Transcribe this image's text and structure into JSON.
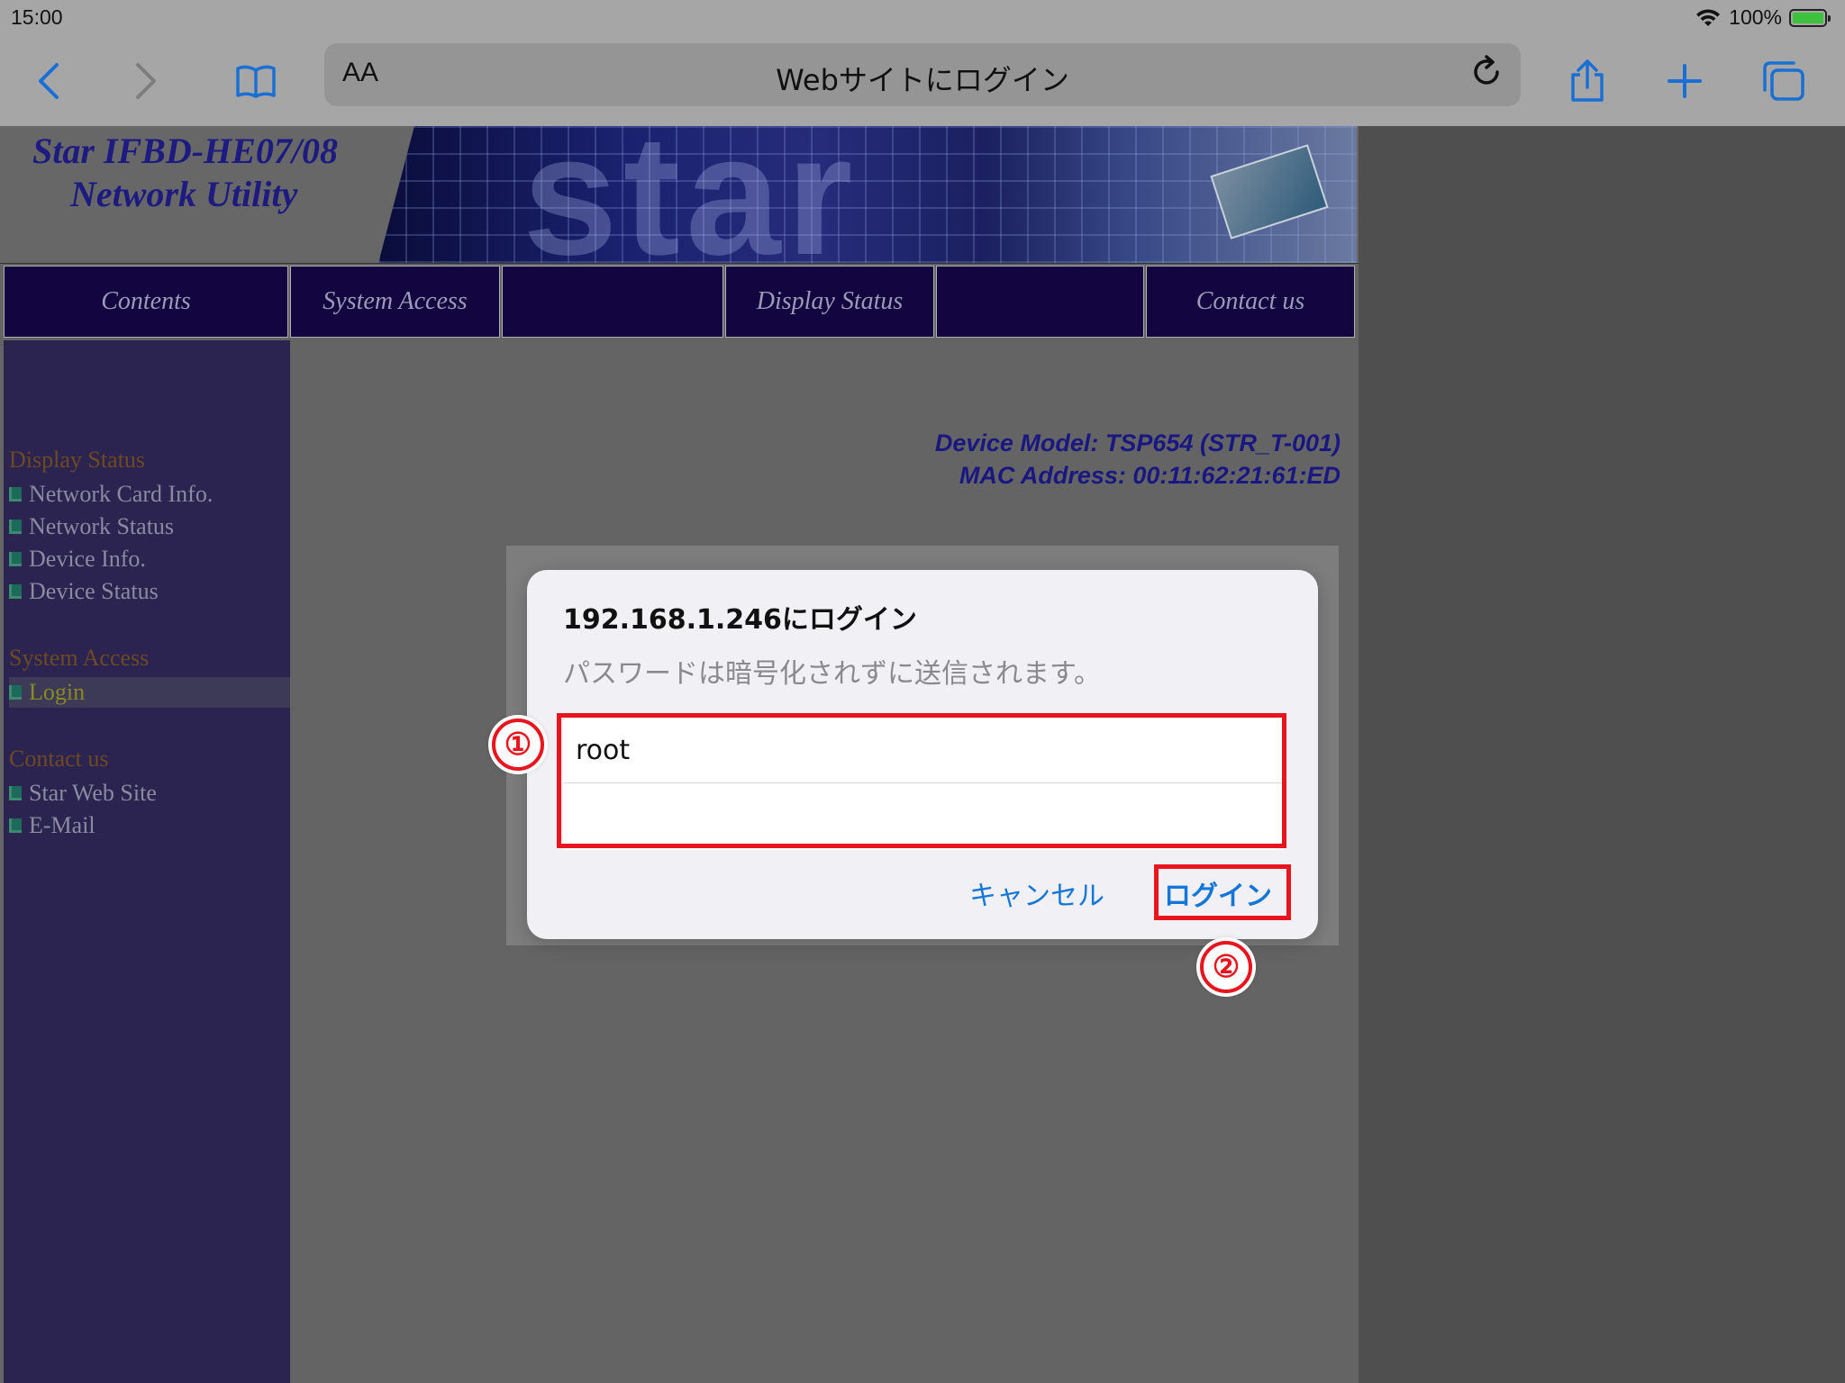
{
  "status_bar": {
    "time": "15:00",
    "battery": "100%"
  },
  "browser": {
    "text_size_label": "AA",
    "page_title": "Webサイトにログイン"
  },
  "page": {
    "banner": {
      "title_line1": "Star IFBD-HE07/08",
      "title_line2": "Network Utility",
      "art_word": "star"
    },
    "nav": [
      {
        "label": "Contents"
      },
      {
        "label": "System Access"
      },
      {
        "label": ""
      },
      {
        "label": "Display Status"
      },
      {
        "label": ""
      },
      {
        "label": "Contact us"
      }
    ],
    "sidebar": {
      "sections": [
        {
          "title": "Display Status",
          "items": [
            "Network Card Info.",
            "Network Status",
            "Device Info.",
            "Device Status"
          ]
        },
        {
          "title": "System Access",
          "items": [
            "Login"
          ]
        },
        {
          "title": "Contact us",
          "items": [
            "Star Web Site",
            "E-Mail"
          ]
        }
      ],
      "active_item": "Login"
    },
    "device_info": {
      "model": "Device Model: TSP654 (STR_T-001)",
      "mac": "MAC Address: 00:11:62:21:61:ED"
    }
  },
  "dialog": {
    "title": "192.168.1.246にログイン",
    "message": "パスワードは暗号化されずに送信されます。",
    "username_value": "root",
    "password_value": "",
    "cancel_label": "キャンセル",
    "login_label": "ログイン"
  },
  "annotations": {
    "marker1": "①",
    "marker2": "②",
    "color": "#e8141e"
  },
  "colors": {
    "link_blue": "#1476d6",
    "nav_bg": "#13053f",
    "sidebar_bg": "#2c2450",
    "title_blue": "#1d1a80"
  },
  "icons": [
    "back-chevron-icon",
    "forward-chevron-icon",
    "bookmarks-icon",
    "reload-icon",
    "share-icon",
    "new-tab-icon",
    "tabs-icon",
    "wifi-icon",
    "battery-icon"
  ]
}
